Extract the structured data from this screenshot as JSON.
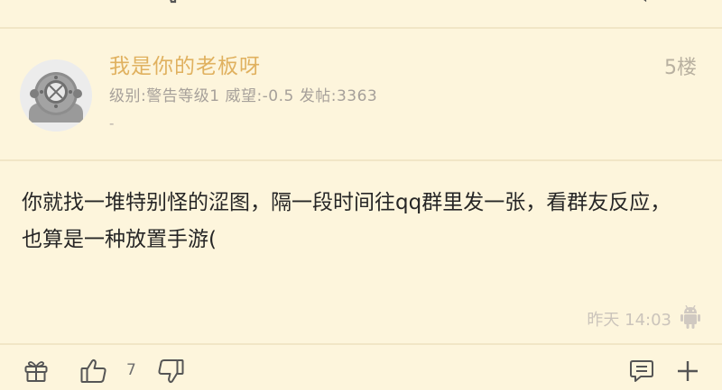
{
  "post": {
    "username": "我是你的老板呀",
    "floor": "5楼",
    "meta": "级别:警告等级1 威望:-0.5 发帖:3363",
    "signature": "-",
    "content": "你就找一堆特别怪的涩图，隔一段时间往qq群里发一张，看群友反应，也算是一种放置手游(",
    "time": "昨天 14:03",
    "like_count": "7"
  },
  "icons": {
    "gift": "gift-icon",
    "like": "thumbs-up-icon",
    "dislike": "thumbs-down-icon",
    "reply": "comment-icon",
    "more": "plus-icon",
    "client": "android-icon"
  },
  "colors": {
    "background": "#fdf5dc",
    "username": "#e0b15f",
    "text": "#262626",
    "muted": "#a6a09a"
  }
}
